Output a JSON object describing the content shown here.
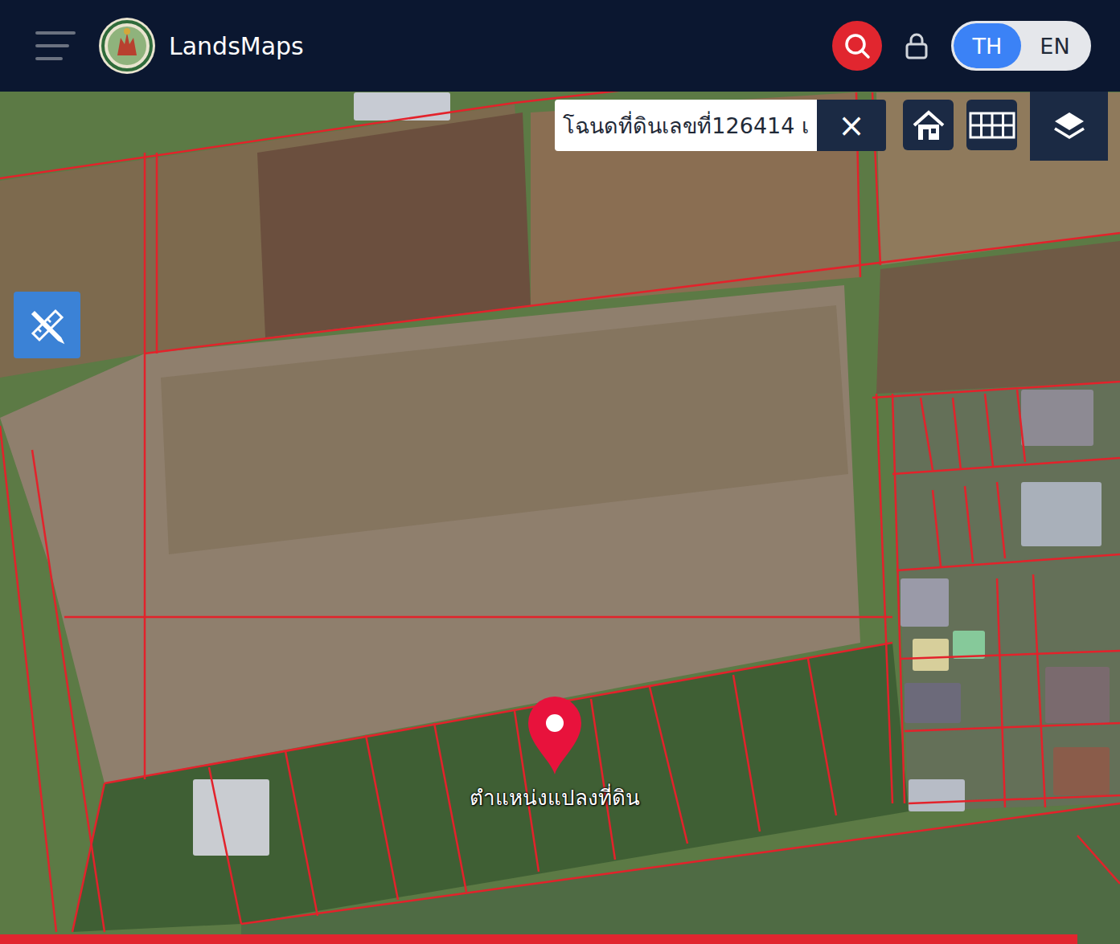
{
  "header": {
    "title": "LandsMaps",
    "languages": [
      {
        "label": "TH",
        "selected": true
      },
      {
        "label": "EN",
        "selected": false
      }
    ]
  },
  "search": {
    "value": "โฉนดที่ดินเลขที่126414 เ",
    "clear": "×"
  },
  "marker": {
    "label": "ตำแหน่งแปลงที่ดิน"
  }
}
